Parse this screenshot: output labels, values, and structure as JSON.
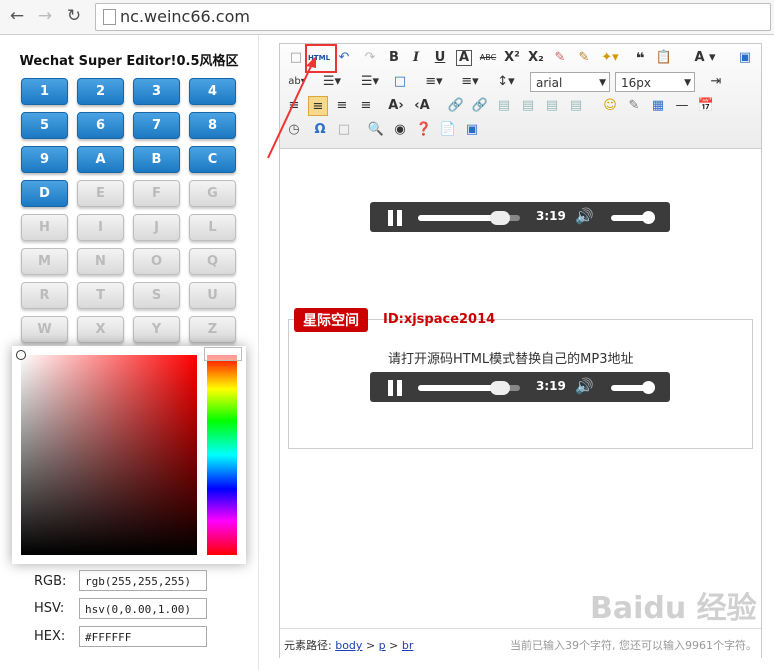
{
  "browser": {
    "url": "nc.weinc66.com",
    "back_icon": "arrow-left-icon",
    "forward_icon": "arrow-right-icon",
    "reload_icon": "reload-icon"
  },
  "sidebar": {
    "title": "Wechat Super Editor!0.5风格区",
    "keys": [
      "1",
      "2",
      "3",
      "4",
      "5",
      "6",
      "7",
      "8",
      "9",
      "A",
      "B",
      "C",
      "D",
      "E",
      "F",
      "G",
      "H",
      "I",
      "J",
      "L",
      "M",
      "N",
      "O",
      "Q",
      "R",
      "T",
      "S",
      "U",
      "W",
      "X",
      "Y",
      "Z"
    ],
    "active_count": 13,
    "colors": {
      "key_active": "#2a8bd6",
      "key_inactive": "#e4e4e4"
    }
  },
  "color_picker": {
    "rgb_label": "RGB:",
    "rgb_value": "rgb(255,255,255)",
    "hsv_label": "HSV:",
    "hsv_value": "hsv(0,0.00,1.00)",
    "hex_label": "HEX:",
    "hex_value": "#FFFFFF"
  },
  "toolbar": {
    "html_label": "HTML",
    "font_family": "arial",
    "font_size": "16px"
  },
  "content": {
    "player1": {
      "time": "3:19",
      "progress": 0.85,
      "volume": 0.9
    },
    "badge": "星际空间",
    "id_text": "ID:xjspace2014",
    "hint": "请打开源码HTML模式替换自己的MP3地址",
    "player2": {
      "time": "3:19",
      "progress": 0.85,
      "volume": 0.9
    }
  },
  "statusbar": {
    "path_label": "元素路径:",
    "path_items": [
      "body",
      "p",
      "br"
    ],
    "sep": ">",
    "count_text": "当前已输入39个字符, 您还可以输入9961个字符。"
  },
  "watermark": "Baidu 经验"
}
